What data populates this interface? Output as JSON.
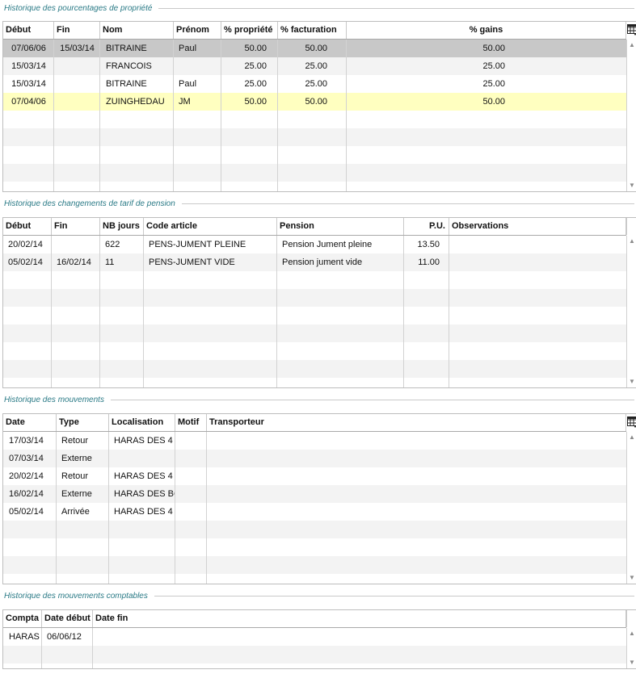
{
  "sections": {
    "proprietes": {
      "title": "Historique des pourcentages de propriété",
      "headers": [
        "Début",
        "Fin",
        "Nom",
        "Prénom",
        "% propriété",
        "% facturation",
        "% gains"
      ],
      "rows": [
        [
          "07/06/06",
          "15/03/14",
          "BITRAINE",
          "Paul",
          "50.00",
          "50.00",
          "50.00"
        ],
        [
          "15/03/14",
          "",
          "FRANCOIS",
          "",
          "25.00",
          "25.00",
          "25.00"
        ],
        [
          "15/03/14",
          "",
          "BITRAINE",
          "Paul",
          "25.00",
          "25.00",
          "25.00"
        ],
        [
          "07/04/06",
          "",
          "ZUINGHEDAU",
          "JM",
          "50.00",
          "50.00",
          "50.00"
        ]
      ]
    },
    "tarifs": {
      "title": "Historique des changements de tarif de pension",
      "headers": [
        "Début",
        "Fin",
        "NB jours",
        "Code article",
        "Pension",
        "P.U.",
        "Observations"
      ],
      "rows": [
        [
          "20/02/14",
          "",
          "622",
          "PENS-JUMENT PLEINE",
          "Pension Jument pleine",
          "13.50",
          ""
        ],
        [
          "05/02/14",
          "16/02/14",
          "11",
          "PENS-JUMENT VIDE",
          "Pension jument vide",
          "11.00",
          ""
        ]
      ]
    },
    "mouvements": {
      "title": "Historique des mouvements",
      "headers": [
        "Date",
        "Type",
        "Localisation",
        "Motif",
        "Transporteur"
      ],
      "rows": [
        [
          "17/03/14",
          "Retour",
          "HARAS DES 4",
          "",
          ""
        ],
        [
          "07/03/14",
          "Externe",
          "",
          "",
          ""
        ],
        [
          "20/02/14",
          "Retour",
          "HARAS DES 4",
          "",
          ""
        ],
        [
          "16/02/14",
          "Externe",
          "HARAS DES BC",
          "",
          ""
        ],
        [
          "05/02/14",
          "Arrivée",
          "HARAS DES 4",
          "",
          ""
        ]
      ]
    },
    "comptables": {
      "title": "Historique des mouvements comptables",
      "headers": [
        "Compta",
        "Date début",
        "Date fin"
      ],
      "rows": [
        [
          "HARAS",
          "06/06/12",
          ""
        ]
      ]
    }
  },
  "icons": {
    "grid_menu": "grid-columns-icon",
    "scroll_up": "scroll-up-arrow-icon",
    "scroll_down": "scroll-down-arrow-icon"
  },
  "colors": {
    "section_title": "#2a7a86",
    "selected_row": "#c8c8c8",
    "highlight_row": "#ffffc0",
    "alt_row": "#f3f3f3"
  }
}
